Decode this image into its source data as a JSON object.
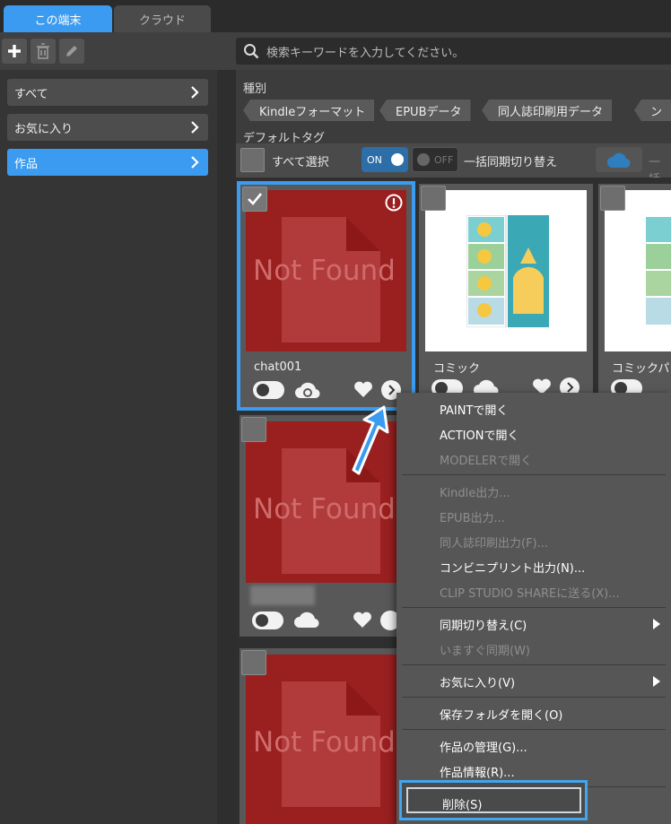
{
  "tabs": {
    "local": "この端末",
    "cloud": "クラウド"
  },
  "search": {
    "placeholder": "検索キーワードを入力してください。"
  },
  "sidebar": {
    "items": [
      {
        "label": "すべて"
      },
      {
        "label": "お気に入り"
      },
      {
        "label": "作品"
      }
    ]
  },
  "filter": {
    "type_label": "種別",
    "tags": [
      "Kindleフォーマット",
      "EPUBデータ",
      "同人誌印刷用データ",
      "コンビ"
    ],
    "default_tag_label": "デフォルトタグ"
  },
  "select_row": {
    "select_all": "すべて選択",
    "on": "ON",
    "off": "OFF",
    "bulk_sync": "一括同期切り替え",
    "bulk_partial": "一括"
  },
  "cards": [
    {
      "title": "chat001",
      "thumb_text": "Not Found"
    },
    {
      "title": "コミック"
    },
    {
      "title": "コミックパター"
    },
    {
      "title": "",
      "thumb_text": "Not Found"
    },
    {
      "title": "",
      "thumb_text": "Not Found"
    }
  ],
  "context_menu": {
    "items": [
      {
        "label": "PAINTで開く",
        "enabled": true
      },
      {
        "label": "ACTIONで開く",
        "enabled": true
      },
      {
        "label": "MODELERで開く",
        "enabled": false
      },
      {
        "label": "Kindle出力...",
        "enabled": false
      },
      {
        "label": "EPUB出力...",
        "enabled": false
      },
      {
        "label": "同人誌印刷出力(F)...",
        "enabled": false
      },
      {
        "label": "コンビニプリント出力(N)...",
        "enabled": true
      },
      {
        "label": "CLIP STUDIO SHAREに送る(X)...",
        "enabled": false
      },
      {
        "label": "同期切り替え(C)",
        "enabled": true
      },
      {
        "label": "いますぐ同期(W)",
        "enabled": false
      },
      {
        "label": "お気に入り(V)",
        "enabled": true
      },
      {
        "label": "保存フォルダを開く(O)",
        "enabled": true
      },
      {
        "label": "作品の管理(G)...",
        "enabled": true
      },
      {
        "label": "作品情報(R)...",
        "enabled": true
      },
      {
        "label": "削除(S)",
        "enabled": true
      }
    ]
  },
  "colors": {
    "accent": "#3a9bf0",
    "not_found_bg": "#9a1f1f",
    "menu_bg": "#565656"
  }
}
